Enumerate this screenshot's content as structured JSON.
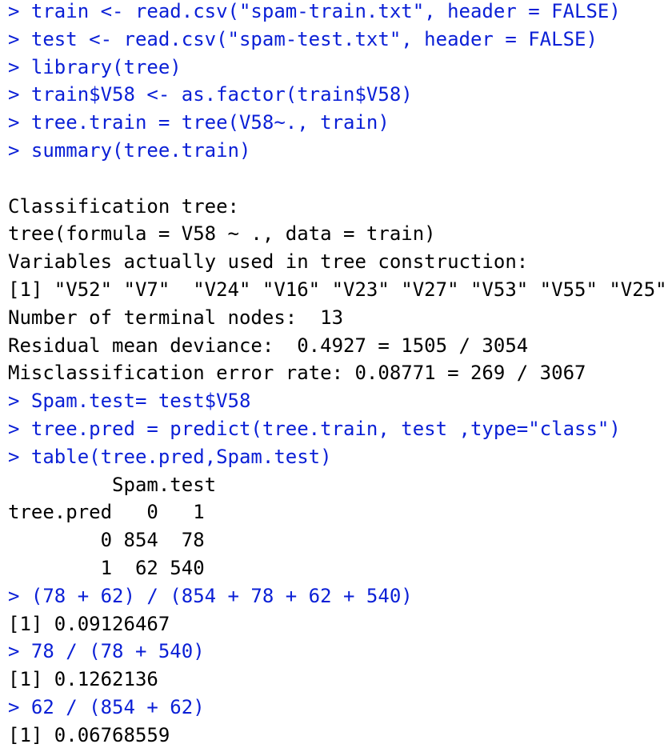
{
  "console": {
    "colors": {
      "input": "#0a1fd6",
      "output": "#000000",
      "background": "#ffffff"
    },
    "lines": [
      {
        "kind": "input",
        "text": "> train <- read.csv(\"spam-train.txt\", header = FALSE)"
      },
      {
        "kind": "input",
        "text": "> test <- read.csv(\"spam-test.txt\", header = FALSE)"
      },
      {
        "kind": "input",
        "text": "> library(tree)"
      },
      {
        "kind": "input",
        "text": "> train$V58 <- as.factor(train$V58)"
      },
      {
        "kind": "input",
        "text": "> tree.train = tree(V58~., train)"
      },
      {
        "kind": "input",
        "text": "> summary(tree.train)"
      },
      {
        "kind": "blank",
        "text": ""
      },
      {
        "kind": "output",
        "text": "Classification tree:"
      },
      {
        "kind": "output",
        "text": "tree(formula = V58 ~ ., data = train)"
      },
      {
        "kind": "output",
        "text": "Variables actually used in tree construction:"
      },
      {
        "kind": "output",
        "text": "[1] \"V52\" \"V7\"  \"V24\" \"V16\" \"V23\" \"V27\" \"V53\" \"V55\" \"V25\""
      },
      {
        "kind": "output",
        "text": "Number of terminal nodes:  13"
      },
      {
        "kind": "output",
        "text": "Residual mean deviance:  0.4927 = 1505 / 3054"
      },
      {
        "kind": "output",
        "text": "Misclassification error rate: 0.08771 = 269 / 3067"
      },
      {
        "kind": "input",
        "text": "> Spam.test= test$V58"
      },
      {
        "kind": "input",
        "text": "> tree.pred = predict(tree.train, test ,type=\"class\")"
      },
      {
        "kind": "input",
        "text": "> table(tree.pred,Spam.test)"
      },
      {
        "kind": "output",
        "text": "         Spam.test"
      },
      {
        "kind": "output",
        "text": "tree.pred   0   1"
      },
      {
        "kind": "output",
        "text": "        0 854  78"
      },
      {
        "kind": "output",
        "text": "        1  62 540"
      },
      {
        "kind": "input",
        "text": "> (78 + 62) / (854 + 78 + 62 + 540)"
      },
      {
        "kind": "output",
        "text": "[1] 0.09126467"
      },
      {
        "kind": "input",
        "text": "> 78 / (78 + 540)"
      },
      {
        "kind": "output",
        "text": "[1] 0.1262136"
      },
      {
        "kind": "input",
        "text": "> 62 / (854 + 62)"
      },
      {
        "kind": "output",
        "text": "[1] 0.06768559"
      }
    ]
  }
}
